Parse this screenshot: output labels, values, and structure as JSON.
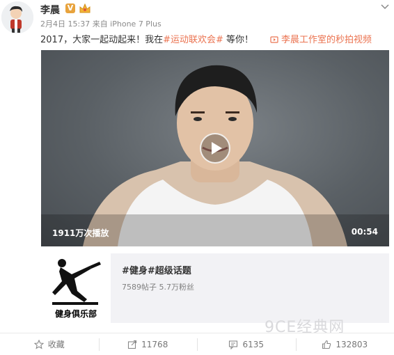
{
  "post": {
    "author": "李晨",
    "verified_badge": "V",
    "meta": "2月4日 15:37 来自 iPhone 7 Plus",
    "text_before": "2017，大家一起动起来！我在",
    "hashtag": "#运动联欢会#",
    "text_after": " 等你！",
    "video_link": "李晨工作室的秒拍视频"
  },
  "video": {
    "plays": "1911万次播放",
    "duration": "00:54"
  },
  "topic": {
    "image_label": "健身俱乐部",
    "title": "#健身#超级话题",
    "stats": "7589帖子 5.7万粉丝"
  },
  "watermark": "9CE经典网",
  "actions": [
    {
      "icon": "star-icon",
      "label": "收藏"
    },
    {
      "icon": "share-icon",
      "label": "11768"
    },
    {
      "icon": "comment-icon",
      "label": "6135"
    },
    {
      "icon": "thumbs-up-icon",
      "label": "132803"
    }
  ],
  "colors": {
    "accent": "#eb7350",
    "verified": "#e8a33d"
  }
}
